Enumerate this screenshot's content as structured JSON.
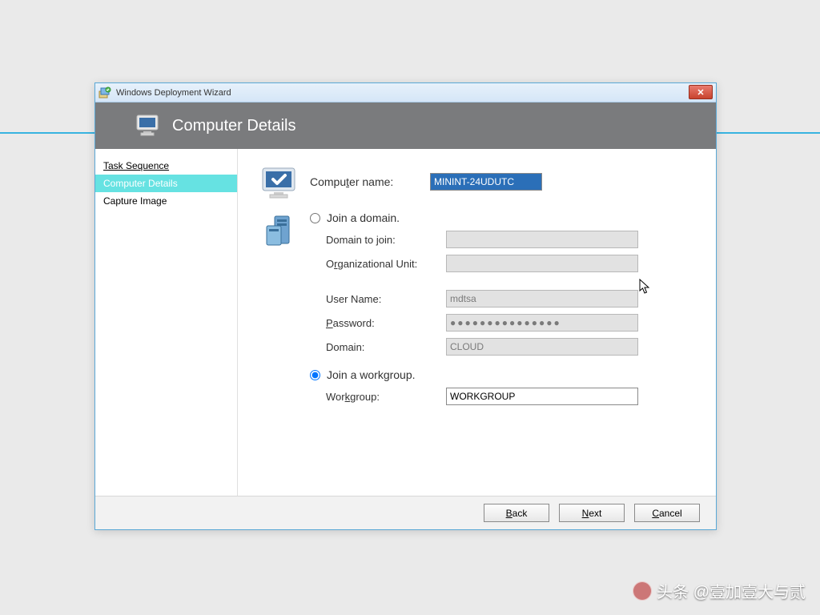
{
  "window": {
    "title": "Windows Deployment Wizard",
    "close_symbol": "✕"
  },
  "header": {
    "title": "Computer Details"
  },
  "sidebar": {
    "items": [
      {
        "label": "Task Sequence",
        "active": false
      },
      {
        "label": "Computer Details",
        "active": true
      },
      {
        "label": "Capture Image",
        "active": false
      }
    ]
  },
  "form": {
    "computer_name_label_pre": "Compu",
    "computer_name_label_u": "t",
    "computer_name_label_post": "er name:",
    "computer_name_value": "MININT-24UDUTC",
    "join_domain_pre": "Join a ",
    "join_domain_u": "d",
    "join_domain_post": "omain.",
    "domain_to_join_label": "Domain to join:",
    "ou_pre": "O",
    "ou_u": "r",
    "ou_post": "ganizational Unit:",
    "user_name_label": "User Name:",
    "user_name_value": "mdtsa",
    "password_u": "P",
    "password_post": "assword:",
    "password_value": "●●●●●●●●●●●●●●●",
    "cred_domain_label": "Domain:",
    "cred_domain_value": "CLOUD",
    "join_workgroup_pre": "Join a ",
    "join_workgroup_u": "w",
    "join_workgroup_post": "orkgroup.",
    "workgroup_u": "k",
    "workgroup_pre": "Wor",
    "workgroup_post": "group:",
    "workgroup_value": "WORKGROUP"
  },
  "footer": {
    "back_u": "B",
    "back_post": "ack",
    "next_u": "N",
    "next_post": "ext",
    "cancel_u": "C",
    "cancel_post": "ancel"
  },
  "watermark": {
    "text": "头条 @壹加壹大与贰"
  }
}
